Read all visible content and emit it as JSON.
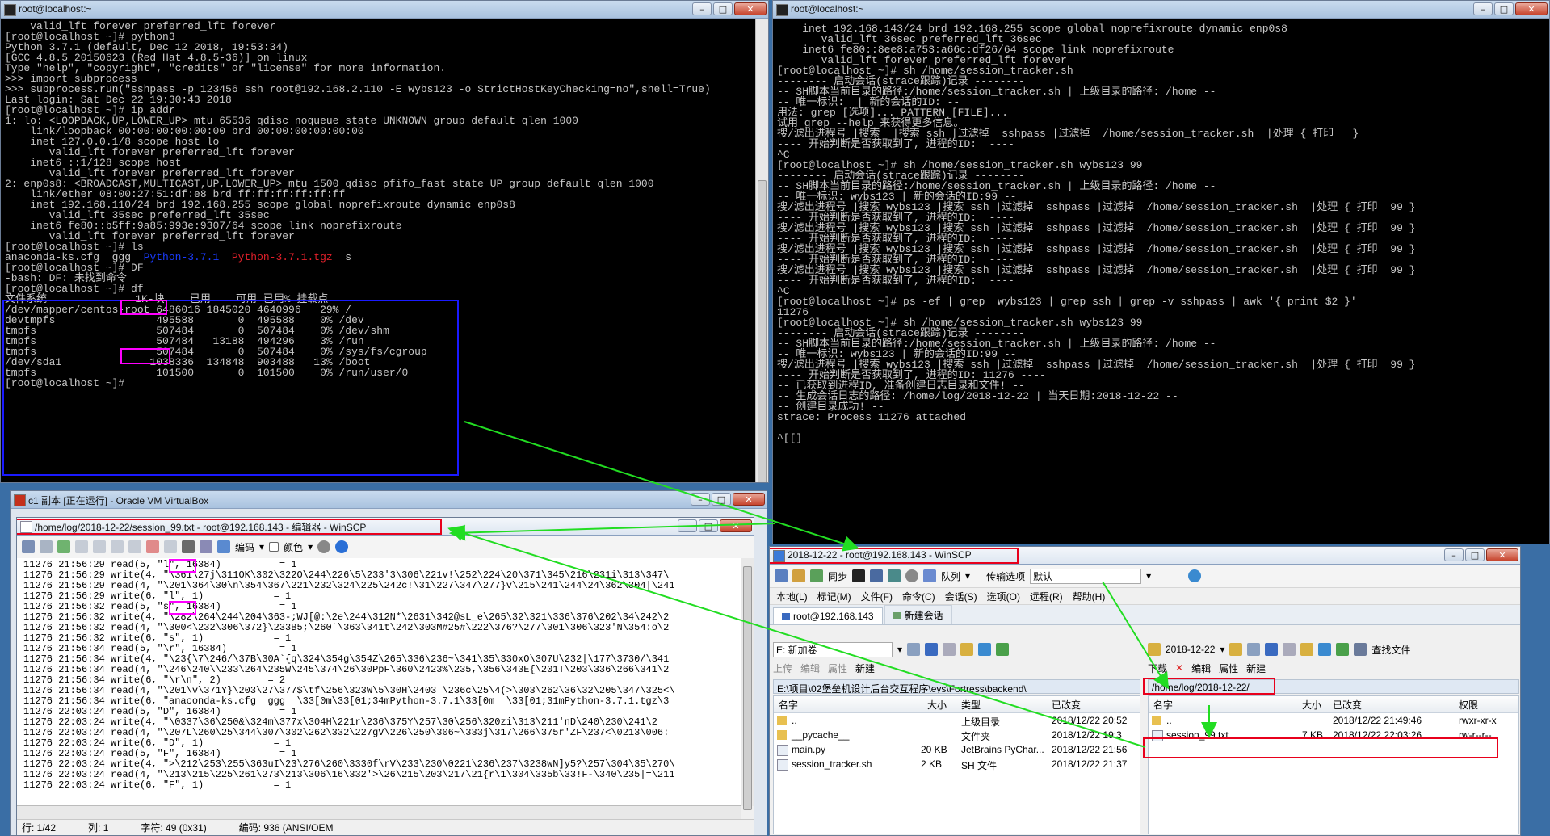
{
  "term_left": {
    "title": "root@localhost:~",
    "lines": [
      "    valid_lft forever preferred_lft forever",
      "[root@localhost ~]# python3",
      "Python 3.7.1 (default, Dec 12 2018, 19:53:34)",
      "[GCC 4.8.5 20150623 (Red Hat 4.8.5-36)] on linux",
      "Type \"help\", \"copyright\", \"credits\" or \"license\" for more information.",
      ">>> import subprocess",
      ">>> subprocess.run(\"sshpass -p 123456 ssh root@192.168.2.110 -E wybs123 -o StrictHostKeyChecking=no\",shell=True)",
      "Last login: Sat Dec 22 19:30:43 2018",
      "[root@localhost ~]# ip addr",
      "1: lo: <LOOPBACK,UP,LOWER_UP> mtu 65536 qdisc noqueue state UNKNOWN group default qlen 1000",
      "    link/loopback 00:00:00:00:00:00 brd 00:00:00:00:00:00",
      "    inet 127.0.0.1/8 scope host lo",
      "       valid_lft forever preferred_lft forever",
      "    inet6 ::1/128 scope host",
      "       valid_lft forever preferred_lft forever",
      "2: enp0s8: <BROADCAST,MULTICAST,UP,LOWER_UP> mtu 1500 qdisc pfifo_fast state UP group default qlen 1000",
      "    link/ether 08:00:27:51:df:e8 brd ff:ff:ff:ff:ff:ff",
      "    inet 192.168.110/24 brd 192.168.255 scope global noprefixroute dynamic enp0s8",
      "       valid_lft 35sec preferred_lft 35sec",
      "    inet6 fe80::b5ff:9a85:993e:9307/64 scope link noprefixroute",
      "       valid_lft forever preferred_lft forever",
      "[root@localhost ~]# ls",
      "anaconda-ks.cfg  ggg  Python-3.7.1  Python-3.7.1.tgz  s",
      "[root@localhost ~]# DF",
      "-bash: DF: 未找到命令",
      "[root@localhost ~]# df",
      "文件系统              1K-块    已用    可用 已用% 挂载点",
      "/dev/mapper/centos-root 6486016 1845020 4640996   29% /",
      "devtmpfs                495588       0  495588    0% /dev",
      "tmpfs                   507484       0  507484    0% /dev/shm",
      "tmpfs                   507484   13188  494296    3% /run",
      "tmpfs                   507484       0  507484    0% /sys/fs/cgroup",
      "/dev/sda1              1038336  134848  903488   13% /boot",
      "tmpfs                   101500       0  101500    0% /run/user/0",
      "[root@localhost ~]# "
    ]
  },
  "term_right": {
    "title": "root@localhost:~",
    "lines": [
      "    inet 192.168.143/24 brd 192.168.255 scope global noprefixroute dynamic enp0s8",
      "       valid_lft 36sec preferred_lft 36sec",
      "    inet6 fe80::8ee8:a753:a66c:df26/64 scope link noprefixroute",
      "       valid_lft forever preferred_lft forever",
      "[root@localhost ~]# sh /home/session_tracker.sh",
      "-------- 启动会话(strace跟踪)记录 --------",
      "-- SH脚本当前目录的路径:/home/session_tracker.sh | 上级目录的路径: /home --",
      "-- 唯一标识:  | 新的会话的ID: --",
      "用法: grep [选项]... PATTERN [FILE]...",
      "试用 grep --help 来获得更多信息。",
      "搜/滤出进程号 |搜索  |搜索 ssh |过滤掉  sshpass |过滤掉  /home/session_tracker.sh  |处理 { 打印   }",
      "---- 开始判断是否获取到了, 进程的ID:  ----",
      "^C",
      "[root@localhost ~]# sh /home/session_tracker.sh wybs123 99",
      "-------- 启动会话(strace跟踪)记录 --------",
      "-- SH脚本当前目录的路径:/home/session_tracker.sh | 上级目录的路径: /home --",
      "-- 唯一标识: wybs123 | 新的会话的ID:99 --",
      "搜/滤出进程号 |搜索 wybs123 |搜索 ssh |过滤掉  sshpass |过滤掉  /home/session_tracker.sh  |处理 { 打印  99 }",
      "---- 开始判断是否获取到了, 进程的ID:  ----",
      "搜/滤出进程号 |搜索 wybs123 |搜索 ssh |过滤掉  sshpass |过滤掉  /home/session_tracker.sh  |处理 { 打印  99 }",
      "---- 开始判断是否获取到了, 进程的ID:  ----",
      "搜/滤出进程号 |搜索 wybs123 |搜索 ssh |过滤掉  sshpass |过滤掉  /home/session_tracker.sh  |处理 { 打印  99 }",
      "---- 开始判断是否获取到了, 进程的ID:  ----",
      "搜/滤出进程号 |搜索 wybs123 |搜索 ssh |过滤掉  sshpass |过滤掉  /home/session_tracker.sh  |处理 { 打印  99 }",
      "---- 开始判断是否获取到了, 进程的ID:  ----",
      "^C",
      "[root@localhost ~]# ps -ef | grep  wybs123 | grep ssh | grep -v sshpass | awk '{ print $2 }'",
      "11276",
      "[root@localhost ~]# sh /home/session_tracker.sh wybs123 99",
      "-------- 启动会话(strace跟踪)记录 --------",
      "-- SH脚本当前目录的路径:/home/session_tracker.sh | 上级目录的路径: /home --",
      "-- 唯一标识: wybs123 | 新的会话的ID:99 --",
      "搜/滤出进程号 |搜索 wybs123 |搜索 ssh |过滤掉  sshpass |过滤掉  /home/session_tracker.sh  |处理 { 打印  99 }",
      "---- 开始判断是否获取到了, 进程的ID: 11276 ----",
      "-- 已获取到进程ID, 准备创建日志目录和文件! --",
      "-- 生成会话日志的路径: /home/log/2018-12-22 | 当天日期:2018-12-22 --",
      "-- 创建目录成功! --",
      "strace: Process 11276 attached",
      "",
      "^[[]"
    ]
  },
  "vbox": {
    "title": "c1 副本 [正在运行] - Oracle VM VirtualBox"
  },
  "editor": {
    "title": "/home/log/2018-12-22/session_99.txt - root@192.168.143 - 编辑器 - WinSCP",
    "encoding_label": "编码",
    "color_label": "颜色",
    "lines": [
      "11276 21:56:29 read(5, \"l\", 16384)          = 1",
      "11276 21:56:29 write(4, \"\\361\\27j\\311OK\\302\\322O\\244\\226\\5\\233'3\\306\\221v!\\252\\224\\20\\371\\345\\216\\231i\\313\\347\\",
      "11276 21:56:29 read(4, \"\\201\\364\\30\\n\\354\\367\\221\\232\\324\\225\\242c!\\31\\227\\347\\277}v\\215\\241\\244\\24\\362\\304|\\241",
      "11276 21:56:29 write(6, \"l\", 1)            = 1",
      "11276 21:56:32 read(5, \"s\", 16384)          = 1",
      "11276 21:56:32 write(4, \"\\282\\264\\244\\204\\363-;WJ[@:\\2e\\244\\312N*\\2631\\342@sL_e\\265\\32\\321\\336\\376\\202\\34\\242\\2",
      "11276 21:56:32 read(4, \"\\300<\\232\\306\\372}\\233B5;\\260`\\363\\341t\\242\\303M#25#\\222\\376?\\277\\301\\306\\323'N\\354:o\\2",
      "11276 21:56:32 write(6, \"s\", 1)            = 1",
      "11276 21:56:34 read(5, \"\\r\", 16384)         = 1",
      "11276 21:56:34 write(4, \"\\23{\\7\\246/\\37B\\30A`{q\\324\\354g\\354Z\\265\\336\\236~\\341\\35\\330xO\\307U\\232|\\177\\3730/\\341",
      "11276 21:56:34 read(4, \"\\246\\240\\\\233\\264\\235W\\245\\374\\26\\30PpF\\360\\2423%\\235,\\356\\343E{\\201T\\203\\336\\266\\341\\2",
      "11276 21:56:34 write(6, \"\\r\\n\", 2)        = 2",
      "11276 21:56:34 read(4, \"\\201\\v\\371Y}\\203\\27\\377$\\tf\\256\\323W\\5\\30H\\2403 \\236c\\25\\4(>\\303\\262\\36\\32\\205\\347\\325<\\",
      "11276 21:56:34 write(6, \"anaconda-ks.cfg  ggg  \\33[0m\\33[01;34mPython-3.7.1\\33[0m  \\33[01;31mPython-3.7.1.tgz\\3",
      "11276 22:03:24 read(5, \"D\", 16384)          = 1",
      "11276 22:03:24 write(4, \"\\0337\\36\\250&\\324m\\377x\\304H\\221r\\236\\375Y\\257\\30\\256\\320zi\\313\\211'nD\\240\\230\\241\\2",
      "11276 22:03:24 read(4, \"\\207L\\260\\25\\344\\307\\302\\262\\332\\227gV\\226\\250\\306~\\333j\\317\\266\\375r'ZF\\237<\\0213\\006:",
      "11276 22:03:24 write(6, \"D\", 1)            = 1",
      "11276 22:03:24 read(5, \"F\", 16384)          = 1",
      "11276 22:03:24 write(4, \">\\212\\253\\255\\363uI\\23\\276\\260\\3330f\\rV\\233\\230\\0221\\236\\237\\3238wN]y5?\\257\\304\\35\\270\\",
      "11276 22:03:24 read(4, \"\\213\\215\\225\\261\\273\\213\\306\\16\\332'>\\26\\215\\203\\217\\21{r\\1\\304\\335b\\33!F-\\340\\235|=\\211",
      "11276 22:03:24 write(6, \"F\", 1)            = 1"
    ],
    "status": {
      "line": "行: 1/42",
      "col": "列: 1",
      "chars": "字符: 49 (0x31)",
      "encoding": "编码: 936  (ANSI/OEM"
    }
  },
  "winscp": {
    "title": "2018-12-22 - root@192.168.143 - WinSCP",
    "toolbar": {
      "sync": "同步",
      "queue": "队列",
      "transfer_label": "传输选项",
      "transfer_value": "默认"
    },
    "menu": [
      "本地(L)",
      "标记(M)",
      "文件(F)",
      "命令(C)",
      "会话(S)",
      "选项(O)",
      "远程(R)",
      "帮助(H)"
    ],
    "tabs": {
      "session": "root@192.168.143",
      "new_session": "新建会话"
    },
    "local": {
      "drive": "E: 新加卷",
      "upload": "上传",
      "edit": "编辑",
      "props": "属性",
      "new": "新建",
      "path": "E:\\项目\\02堡垒机设计后台交互程序\\eys\\Fortress\\backend\\",
      "headers": {
        "name": "名字",
        "size": "大小",
        "type": "类型",
        "modified": "已改变"
      },
      "rows": [
        {
          "name": "..",
          "size": "",
          "type": "上级目录",
          "modified": "2018/12/22  20:52"
        },
        {
          "name": "__pycache__",
          "size": "",
          "type": "文件夹",
          "modified": "2018/12/22  19:3"
        },
        {
          "name": "main.py",
          "size": "20 KB",
          "type": "JetBrains PyChar...",
          "modified": "2018/12/22  21:56"
        },
        {
          "name": "session_tracker.sh",
          "size": "2 KB",
          "type": "SH 文件",
          "modified": "2018/12/22  21:37"
        }
      ]
    },
    "remote": {
      "folder": "2018-12-22",
      "download": "下载",
      "edit": "编辑",
      "props": "属性",
      "new": "新建",
      "find": "查找文件",
      "path": "/home/log/2018-12-22/",
      "headers": {
        "name": "名字",
        "size": "大小",
        "modified": "已改变",
        "perms": "权限"
      },
      "rows": [
        {
          "name": "..",
          "size": "",
          "modified": "2018/12/22 21:49:46",
          "perms": "rwxr-xr-x"
        },
        {
          "name": "session_99.txt",
          "size": "7 KB",
          "modified": "2018/12/22 22:03:26",
          "perms": "rw-r--r--"
        }
      ]
    }
  },
  "colors": {
    "terminal_bg": "#000000",
    "terminal_fg": "#c8c8c8",
    "blue_dir": "#1a3cff",
    "red_archive": "#e0202a",
    "highlight_pink": "#ff00ff",
    "highlight_blue": "#1a1aff",
    "highlight_red": "#e8001c",
    "arrow_green": "#22dd22"
  }
}
